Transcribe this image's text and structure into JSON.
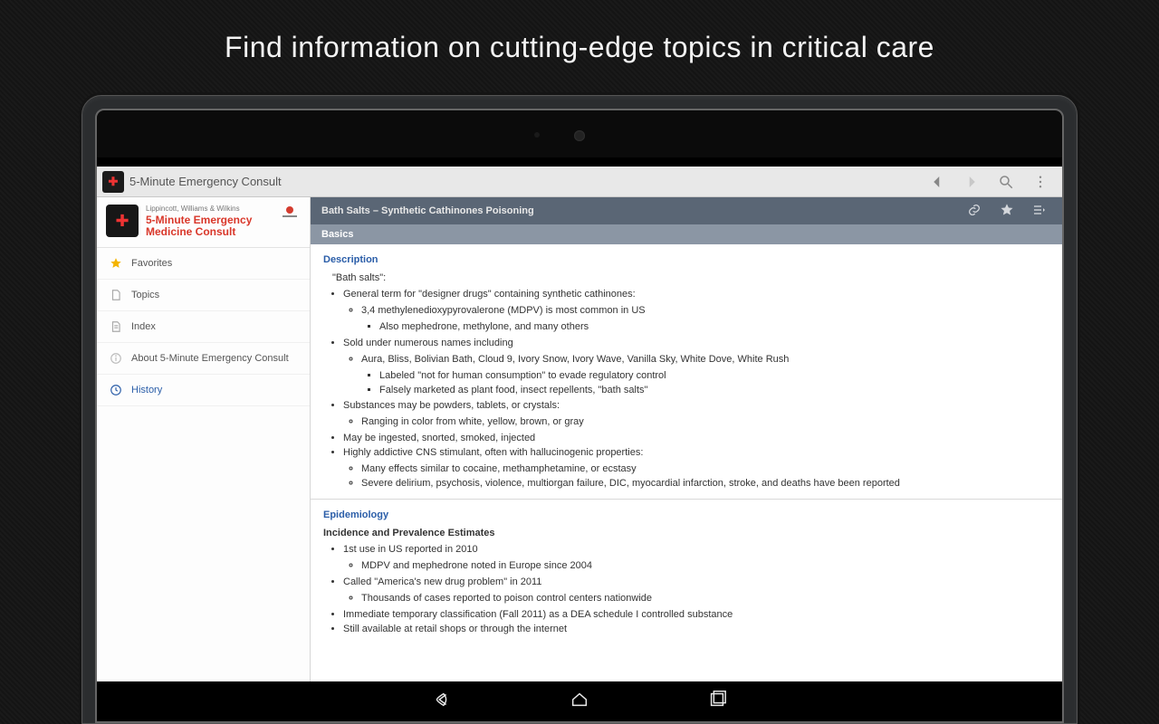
{
  "promo_headline": "Find information on cutting-edge topics in critical care",
  "actionbar": {
    "app_title": "5-Minute Emergency Consult"
  },
  "brand": {
    "publisher": "Lippincott, Williams & Wilkins",
    "title_line1": "5-Minute Emergency",
    "title_line2": "Medicine Consult"
  },
  "sidebar": {
    "items": {
      "favorites": "Favorites",
      "topics": "Topics",
      "index": "Index",
      "about": "About 5-Minute Emergency Consult",
      "history": "History"
    }
  },
  "topic": {
    "title": "Bath Salts – Synthetic Cathinones Poisoning",
    "section": "Basics"
  },
  "description": {
    "heading": "Description",
    "lead": "\"Bath salts\":",
    "b1": "General term for \"designer drugs\" containing synthetic cathinones:",
    "b1a": "3,4 methylenedioxypyrovalerone (MDPV) is most common in US",
    "b1a1": "Also mephedrone, methylone, and many others",
    "b2": "Sold under numerous names including",
    "b2a": "Aura, Bliss, Bolivian Bath, Cloud 9, Ivory Snow, Ivory Wave, Vanilla Sky, White Dove, White Rush",
    "b2a1": "Labeled \"not for human consumption\" to evade regulatory control",
    "b2a2": "Falsely marketed as plant food, insect repellents, \"bath salts\"",
    "b3": "Substances may be powders, tablets, or crystals:",
    "b3a": "Ranging in color from white, yellow, brown, or gray",
    "b4": "May be ingested, snorted, smoked, injected",
    "b5": "Highly addictive CNS stimulant, often with hallucinogenic properties:",
    "b5a": "Many effects similar to cocaine, methamphetamine, or ecstasy",
    "b5b": "Severe delirium, psychosis, violence, multiorgan failure, DIC, myocardial infarction, stroke, and deaths have been reported"
  },
  "epidemiology": {
    "heading": "Epidemiology",
    "sub": "Incidence and Prevalence Estimates",
    "e1": "1st use in US reported in 2010",
    "e1a": "MDPV and mephedrone noted in Europe since 2004",
    "e2": "Called \"America's new drug problem\" in 2011",
    "e2a": "Thousands of cases reported to poison control centers nationwide",
    "e3": "Immediate temporary classification (Fall 2011) as a DEA schedule I controlled substance",
    "e4": "Still available at retail shops or through the internet"
  }
}
